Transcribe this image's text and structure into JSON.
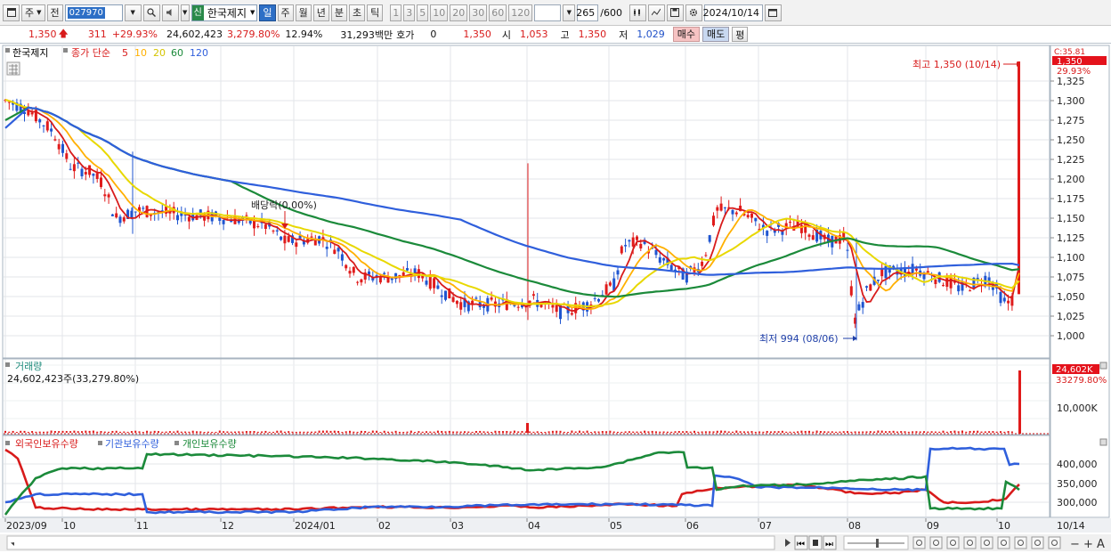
{
  "toolbar": {
    "period_mode": "주",
    "prev_btn": "전",
    "stock_code": "027970",
    "stock_name": "한국제지",
    "shin_badge": "신",
    "period_tabs": [
      "일",
      "주",
      "월",
      "년",
      "분",
      "초",
      "틱"
    ],
    "active_period": "일",
    "interval_buttons": [
      "1",
      "3",
      "5",
      "10",
      "20",
      "30",
      "60",
      "120"
    ],
    "bar_count": "265",
    "bar_total": "/600",
    "date": "2024/10/14"
  },
  "quote": {
    "price": "1,350",
    "change": "311",
    "change_pct": "+29.93%",
    "volume": "24,602,423",
    "volume_pct": "3,279.80%",
    "turnover": "12.94%",
    "amount": "31,293백만",
    "hoga_label": "호가",
    "hoga_value": "0",
    "hoga_price": "1,350",
    "open_label": "시",
    "open": "1,053",
    "high_label": "고",
    "high": "1,350",
    "low_label": "저",
    "low": "1,029",
    "buy": "매수",
    "sell": "매도",
    "eval": "평"
  },
  "price_pane": {
    "stock_label": "한국제지",
    "ma_label": "종가 단순",
    "ma_periods": [
      "5",
      "10",
      "20",
      "60",
      "120"
    ],
    "ma_colors": [
      "#d81b1b",
      "#ffb000",
      "#e8d800",
      "#1b8a3a",
      "#2f5fdc"
    ],
    "current_price_tag": "1,350",
    "current_pct_tag": "29.93%",
    "top_right_label": "C:35.81",
    "max_label": "최고 1,350 (10/14)",
    "min_label": "최저 994 (08/06)",
    "dividend_label": "배당락(0.00%)",
    "yticks": [
      "1,325",
      "1,300",
      "1,275",
      "1,250",
      "1,225",
      "1,200",
      "1,175",
      "1,150",
      "1,125",
      "1,100",
      "1,075",
      "1,050",
      "1,025",
      "1,000"
    ]
  },
  "volume_pane": {
    "title": "거래량",
    "value": "24,602,423주(33,279.80%)",
    "tag_volume": "24,602K",
    "tag_pct": "33279.80%",
    "ytick": "10,000K"
  },
  "holding_pane": {
    "legend": [
      "외국인보유수량",
      "기관보유수량",
      "개인보유수량"
    ],
    "colors": [
      "#d81b1b",
      "#2f5fdc",
      "#1b8a3a"
    ],
    "yticks": [
      "400,000",
      "350,000",
      "300,000"
    ]
  },
  "xaxis": {
    "labels": [
      "2023/09",
      "10",
      "11",
      "12",
      "2024/01",
      "02",
      "03",
      "04",
      "05",
      "06",
      "07",
      "08",
      "09",
      "10"
    ],
    "right_label": "10/14"
  },
  "chart_data": {
    "type": "candlestick",
    "x_range": [
      "2023/09",
      "2024/10/14"
    ],
    "ylim": [
      994,
      1350
    ],
    "max": {
      "value": 1350,
      "date": "10/14"
    },
    "min": {
      "value": 994,
      "date": "08/06"
    },
    "last": {
      "open": 1053,
      "high": 1350,
      "low": 1029,
      "close": 1350,
      "volume": 24602423
    }
  }
}
